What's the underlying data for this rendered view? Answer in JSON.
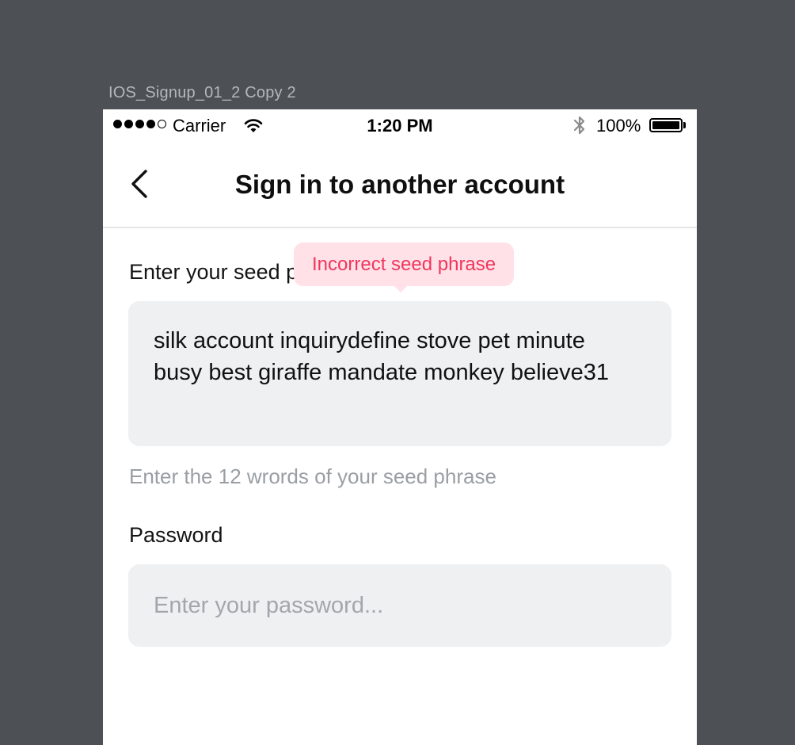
{
  "artboard": {
    "label": "IOS_Signup_01_2 Copy 2"
  },
  "status_bar": {
    "carrier": "Carrier",
    "time": "1:20 PM",
    "battery_percent": "100%",
    "icons": [
      "signal-dots",
      "wifi-icon",
      "bluetooth-icon",
      "battery-icon"
    ]
  },
  "nav": {
    "back_icon": "chevron-left-icon",
    "title": "Sign in to another account"
  },
  "seed": {
    "label": "Enter your seed phrase",
    "value": "silk account inquirydefine stove pet minute busy best giraffe mandate monkey believe31",
    "helper": "Enter the 12 wrords of your seed phrase",
    "error_tooltip": "Incorrect seed phrase"
  },
  "password": {
    "label": "Password",
    "placeholder": "Enter your password..."
  },
  "colors": {
    "background": "#4d5155",
    "input_fill": "#eef0f2",
    "error_text": "#f0365c",
    "error_fill": "#ffe1e7",
    "helper_text": "#9a9ea3"
  }
}
